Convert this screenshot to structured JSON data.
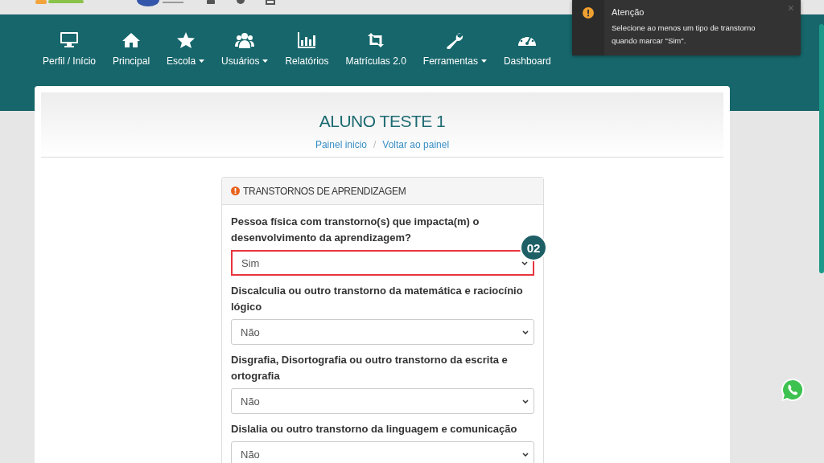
{
  "nav": [
    {
      "kind": "monitor",
      "label": "Perfil / Início",
      "dropdown": false
    },
    {
      "kind": "home",
      "label": "Principal",
      "dropdown": false
    },
    {
      "kind": "star",
      "label": "Escola",
      "dropdown": true
    },
    {
      "kind": "users",
      "label": "Usuários",
      "dropdown": true
    },
    {
      "kind": "chart",
      "label": "Relatórios",
      "dropdown": false
    },
    {
      "kind": "arrows",
      "label": "Matrículas 2.0",
      "dropdown": false
    },
    {
      "kind": "wrench",
      "label": "Ferramentas",
      "dropdown": true
    },
    {
      "kind": "gauge",
      "label": "Dashboard",
      "dropdown": false
    }
  ],
  "toast": {
    "title": "Atenção",
    "message": "Selecione ao menos um tipo de transtorno quando marcar \"Sim\".",
    "close": "×"
  },
  "page": {
    "title": "ALUNO TESTE 1",
    "breadcrumbs": [
      "Painel inicio",
      "Voltar ao painel"
    ],
    "separator": "/"
  },
  "panel": {
    "title": "TRANSTORNOS DE APRENDIZAGEM",
    "fields": [
      {
        "label": "Pessoa física com transtorno(s) que impacta(m) o desenvolvimento da aprendizagem?",
        "value": "Sim",
        "highlighted": true,
        "badge": "02"
      },
      {
        "label": "Discalculia ou outro transtorno da matemática e raciocínio lógico",
        "value": "Não",
        "highlighted": false
      },
      {
        "label": "Disgrafia, Disortografia ou outro transtorno da escrita e ortografia",
        "value": "Não",
        "highlighted": false
      },
      {
        "label": "Dislalia ou outro transtorno da linguagem e comunicação",
        "value": "Não",
        "highlighted": false
      }
    ]
  }
}
